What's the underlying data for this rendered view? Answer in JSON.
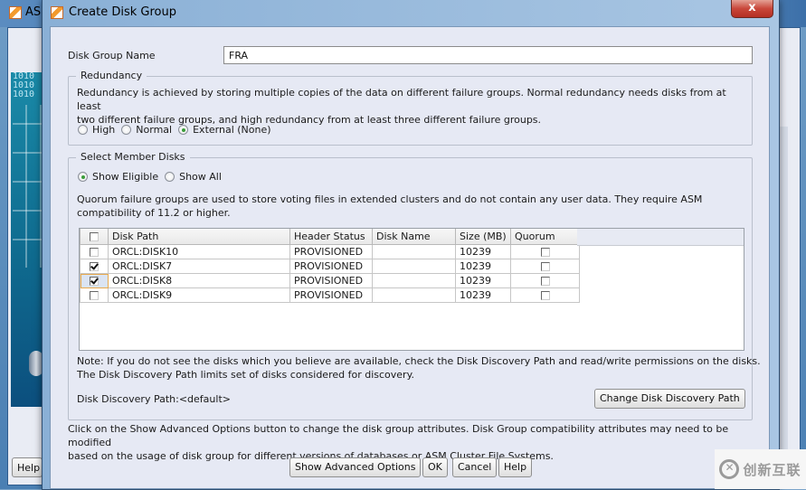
{
  "background_window": {
    "title": "ASM",
    "help_label": "Help"
  },
  "dialog": {
    "title": "Create Disk Group",
    "close_label": "x"
  },
  "disk_group_name": {
    "label": "Disk Group Name",
    "value": "FRA"
  },
  "redundancy": {
    "legend": "Redundancy",
    "description_line1": "Redundancy is achieved by storing multiple copies of the data on different failure groups. Normal redundancy needs disks from at least",
    "description_line2": "two different failure groups, and high redundancy from at least three different failure groups.",
    "options": [
      {
        "label": "High",
        "selected": false
      },
      {
        "label": "Normal",
        "selected": false
      },
      {
        "label": "External (None)",
        "selected": true
      }
    ]
  },
  "member_disks": {
    "legend": "Select Member Disks",
    "filter_options": [
      {
        "label": "Show Eligible",
        "selected": true
      },
      {
        "label": "Show All",
        "selected": false
      }
    ],
    "quorum_note_line1": "Quorum failure groups are used to store voting files in extended clusters and do not contain any user data. They require ASM",
    "quorum_note_line2": "compatibility of 11.2 or higher.",
    "table": {
      "columns": [
        "",
        "Disk Path",
        "Header Status",
        "Disk Name",
        "Size (MB)",
        "Quorum"
      ],
      "rows": [
        {
          "selected": false,
          "disk_path": "ORCL:DISK10",
          "header_status": "PROVISIONED",
          "disk_name": "",
          "size_mb": "10239",
          "quorum": false
        },
        {
          "selected": true,
          "disk_path": "ORCL:DISK7",
          "header_status": "PROVISIONED",
          "disk_name": "",
          "size_mb": "10239",
          "quorum": false
        },
        {
          "selected": true,
          "disk_path": "ORCL:DISK8",
          "header_status": "PROVISIONED",
          "disk_name": "",
          "size_mb": "10239",
          "quorum": false
        },
        {
          "selected": false,
          "disk_path": "ORCL:DISK9",
          "header_status": "PROVISIONED",
          "disk_name": "",
          "size_mb": "10239",
          "quorum": false
        }
      ]
    },
    "discovery_note_line1": "Note: If you do not see the disks which you believe are available, check the Disk Discovery Path and read/write permissions on the disks.",
    "discovery_note_line2": "The Disk Discovery Path limits set of disks considered for discovery.",
    "discovery_path_label": "Disk Discovery Path:<default>",
    "change_path_button": "Change Disk Discovery Path"
  },
  "footer": {
    "advanced_note_line1": "Click on the Show Advanced Options button to change the disk group attributes. Disk Group compatibility attributes may need to be modified",
    "advanced_note_line2": "based on the usage of disk group for different versions of databases or ASM Cluster File Systems.",
    "buttons": {
      "show_advanced": "Show Advanced Options",
      "ok": "OK",
      "cancel": "Cancel",
      "help": "Help"
    }
  },
  "watermark": {
    "text": "创新互联"
  }
}
